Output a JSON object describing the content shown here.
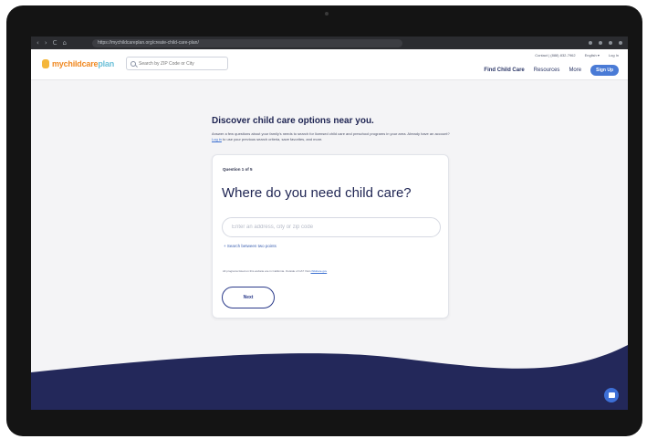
{
  "browser": {
    "nav_back": "‹",
    "nav_forward": "›",
    "nav_reload": "C",
    "nav_home": "⌂",
    "url": "https://mychildcareplan.org/create-child-care-plan/"
  },
  "header": {
    "logo_prefix": "mychildcare",
    "logo_suffix": "plan",
    "search_placeholder": "Search by ZIP Code or City",
    "util_phone": "Contact | (888) 832-7962",
    "util_language": "English ▾",
    "util_login": "Log In",
    "nav": {
      "find": "Find Child Care",
      "resources": "Resources",
      "more": "More",
      "signup": "Sign Up"
    }
  },
  "main": {
    "title": "Discover child care options near you.",
    "intro_before": "Answer a few questions about your family's needs to search for licensed child care and preschool programs in your area. Already have an account? ",
    "intro_link": "Log in",
    "intro_after": " to use your previous search criteria, save favorites, and more."
  },
  "card": {
    "question_count": "Question 1 of 5",
    "question": "Where do you need child care?",
    "address_placeholder": "Enter an address, city or zip code",
    "two_points": "+ Search between two points",
    "disclaimer_text": "All programs listed on this website are in California. Outside of CA? Visit ",
    "disclaimer_link": "childcare.gov",
    "next": "Next"
  },
  "colors": {
    "brand_navy": "#23285a",
    "accent_blue": "#4a7bd6",
    "logo_orange": "#f08a24"
  },
  "apple_logo": ""
}
